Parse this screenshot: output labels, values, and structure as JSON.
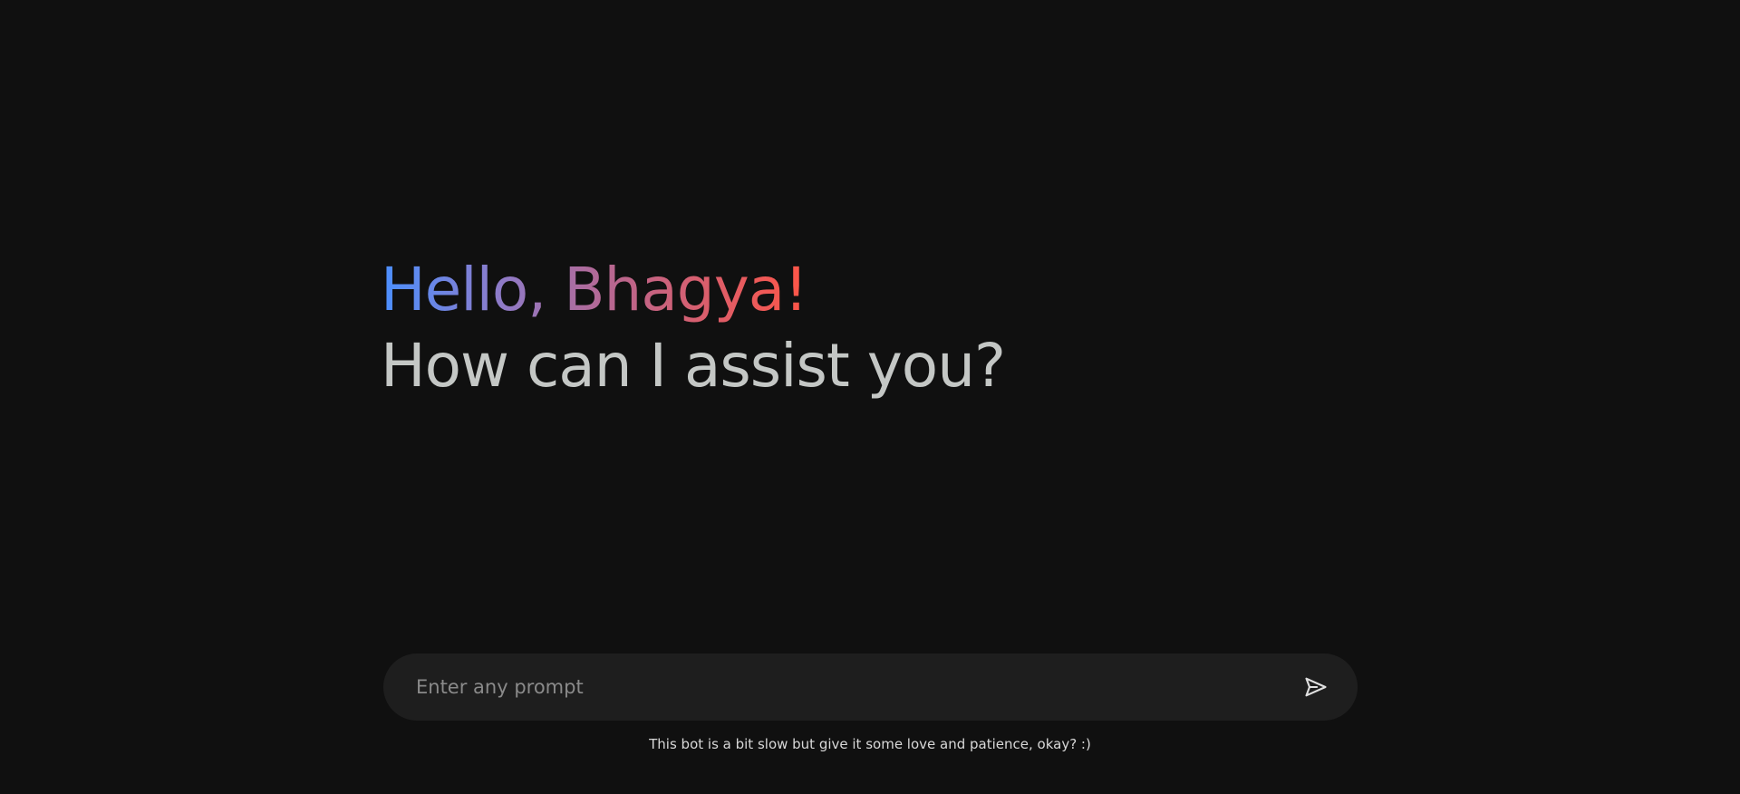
{
  "greeting": {
    "hello": "Hello, Bhagya!",
    "question": "How can I assist you?"
  },
  "prompt": {
    "placeholder": "Enter any prompt",
    "value": ""
  },
  "send": {
    "icon": "send-icon"
  },
  "footer": {
    "note": "This bot is a bit slow but give it some love and patience, okay? :)"
  },
  "colors": {
    "background": "#101010",
    "input_background": "#1e1e1e",
    "question_text": "#c4c7c5",
    "gradient_start": "#4b90ff",
    "gradient_end": "#ff5546"
  }
}
